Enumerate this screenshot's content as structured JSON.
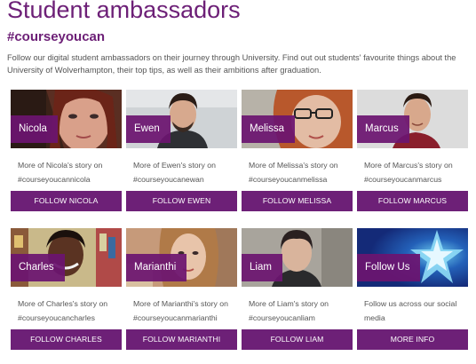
{
  "page": {
    "title": "Student ambassadors",
    "hashtag": "#courseyoucan",
    "intro": "Follow our digital student ambassadors on their journey through University. Find out out students' favourite things about the University of Wolverhampton, their top tips, as well as their ambitions after graduation."
  },
  "cards": [
    {
      "name": "Nicola",
      "story": "More of Nicola's story on #courseyoucannicola",
      "button": "FOLLOW NICOLA"
    },
    {
      "name": "Ewen",
      "story": "More of Ewen's story on #courseyoucanewan",
      "button": "FOLLOW EWEN"
    },
    {
      "name": "Melissa",
      "story": "More of Melissa's story on #courseyoucanmelissa",
      "button": "FOLLOW MELISSA"
    },
    {
      "name": "Marcus",
      "story": "More of Marcus's story on #courseyoucanmarcus",
      "button": "FOLLOW MARCUS"
    },
    {
      "name": "Charles",
      "story": "More of Charles's story on #courseyoucancharles",
      "button": "FOLLOW CHARLES"
    },
    {
      "name": "Marianthi",
      "story": "More of Marianthi's story on #courseyoucanmarianthi",
      "button": "FOLLOW MARIANTHI"
    },
    {
      "name": "Liam",
      "story": "More of Liam's story on #courseyoucanliam",
      "button": "FOLLOW LIAM"
    },
    {
      "name": "Follow Us",
      "story": "Follow us across our social media",
      "button": "MORE INFO"
    }
  ],
  "colors": {
    "brand_purple": "#6d2077",
    "tag_purple": "#6c1470"
  }
}
